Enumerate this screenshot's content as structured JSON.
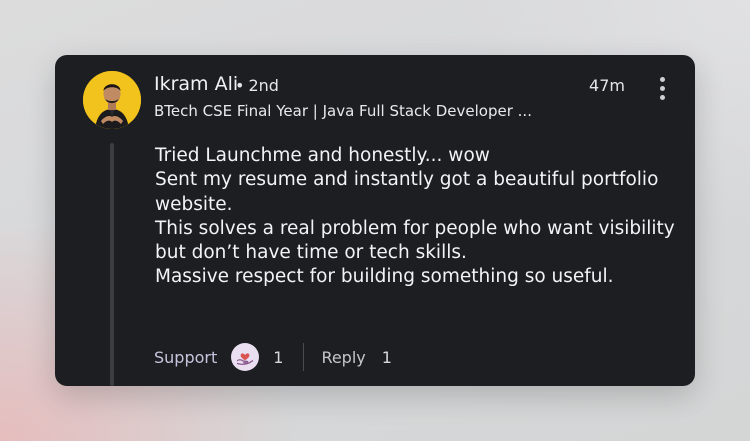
{
  "comment": {
    "author": {
      "name": "Ikram Ali",
      "degree_separator": "•",
      "degree": "2nd",
      "headline": "BTech CSE Final Year | Java Full Stack Developer ..."
    },
    "timestamp": "47m",
    "more_icon": "more-vertical-icon",
    "body_lines": [
      "Tried Launchme and honestly... wow",
      "Sent my resume and instantly got a beautiful portfolio",
      "website.",
      "This solves a real problem for people who want visibility",
      "but don’t have time or tech skills.",
      "Massive respect for building something so useful."
    ],
    "actions": {
      "support_label": "Support",
      "reaction_icon": "support-heart-icon",
      "reaction_count": "1",
      "reply_label": "Reply",
      "reply_count": "1"
    }
  },
  "colors": {
    "card_background": "#1d1e21",
    "avatar_background": "#f2c21d",
    "support_accent": "#c8c4de",
    "thread_line": "#3c3d40"
  }
}
